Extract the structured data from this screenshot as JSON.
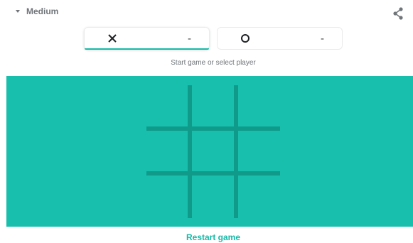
{
  "difficulty": {
    "label": "Medium",
    "icon": "dropdown-caret-icon"
  },
  "share": {
    "icon": "share-icon"
  },
  "players": [
    {
      "symbol": "×",
      "icon": "x-mark-icon",
      "score": "-",
      "active": true
    },
    {
      "symbol": "O",
      "icon": "o-mark-icon",
      "score": "-",
      "active": false
    }
  ],
  "status_text": "Start game or select player",
  "board": {
    "cells": [
      "",
      "",
      "",
      "",
      "",
      "",
      "",
      "",
      ""
    ],
    "colors": {
      "background": "#17bfac",
      "grid_lines": "#0f9a8a",
      "accent": "#16baa8"
    }
  },
  "restart_label": "Restart game"
}
